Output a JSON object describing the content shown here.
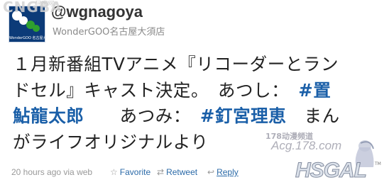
{
  "watermark": {
    "top_left": "CNGBA",
    "top_left_small": "玩家网",
    "right_cn": "178动漫频道",
    "right_url": "Acg.178.com",
    "right_brand": "HSGAL",
    "right_tm": "TM"
  },
  "avatar": {
    "caption": "WonderGOO 名古屋大須店"
  },
  "header": {
    "handle": "@wgnagoya",
    "display_name": "WonderGOO名古屋大須店"
  },
  "tweet": {
    "line1": "１月新番組TVアニメ『リコーダーとラン",
    "line2_a": "ドセル』キャスト決定。　あつし：　",
    "line2_tag": "#置",
    "line3_tag_a": "鮎龍太郎",
    "line3_b": "　　あつみ：　",
    "line3_tag_b": "#釘宮理恵",
    "line3_c": "　まん",
    "line4": "がライフオリジナルより"
  },
  "meta": {
    "time": "20 hours ago via web"
  },
  "actions": {
    "favorite": "Favorite",
    "retweet": "Retweet",
    "reply": "Reply"
  },
  "colors": {
    "hashtag": "#1a5fa8",
    "link": "#2b6aa8",
    "avatar_bg": "#0c3b78",
    "avatar_green": "#2fa02f"
  }
}
